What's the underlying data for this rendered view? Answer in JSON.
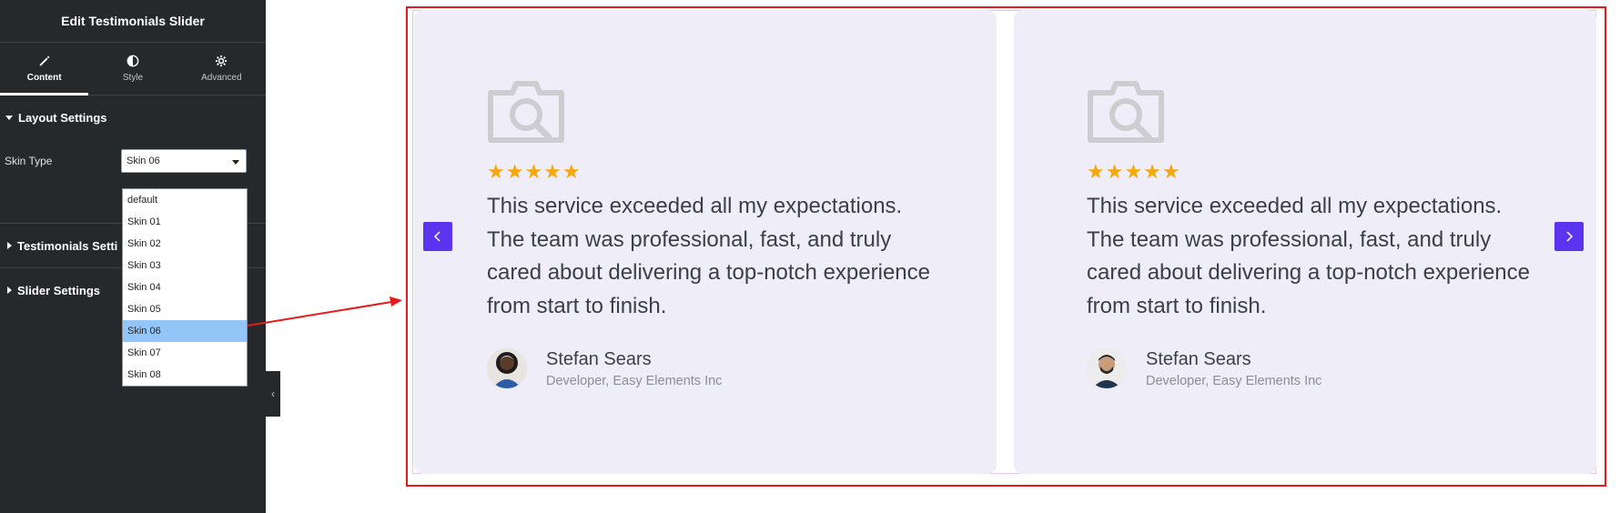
{
  "editor": {
    "title": "Edit Testimonials Slider",
    "tabs": [
      {
        "label": "Content",
        "icon": "pencil-icon",
        "active": true
      },
      {
        "label": "Style",
        "icon": "contrast-icon",
        "active": false
      },
      {
        "label": "Advanced",
        "icon": "gear-icon",
        "active": false
      }
    ],
    "sections": {
      "layout": "Layout Settings",
      "testimonials": "Testimonials Setti",
      "slider": "Slider Settings"
    },
    "skin_type": {
      "label": "Skin Type",
      "value": "Skin 06",
      "options": [
        "default",
        "Skin 01",
        "Skin 02",
        "Skin 03",
        "Skin 04",
        "Skin 05",
        "Skin 06",
        "Skin 07",
        "Skin 08"
      ],
      "selected_index": 6
    }
  },
  "colors": {
    "accent": "#5b34f0",
    "star": "#f5a70d",
    "card_bg": "#eeedf8",
    "annotation": "#e51b1b"
  },
  "testimonials": [
    {
      "rating": 5,
      "stars": "★★★★★",
      "quote": "This service exceeded all my expectations. The team was professional, fast, and truly cared about delivering a top-notch experience from start to finish.",
      "name": "Stefan Sears",
      "role": "Developer, Easy Elements Inc"
    },
    {
      "rating": 5,
      "stars": "★★★★★",
      "quote": "This service exceeded all my expectations. The team was professional, fast, and truly cared about delivering a top-notch experience from start to finish.",
      "name": "Stefan Sears",
      "role": "Developer, Easy Elements Inc"
    }
  ]
}
